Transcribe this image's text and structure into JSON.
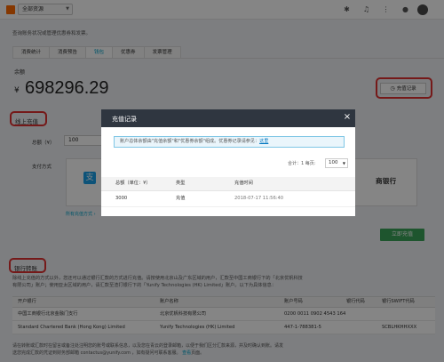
{
  "topbar": {
    "resource_select": "全部资源",
    "icons": [
      "cloudshell-icon",
      "bell-icon",
      "cart-icon",
      "help-icon",
      "avatar"
    ]
  },
  "info_strip": "查询账务状况或管理优惠券和发票。",
  "tabs": [
    {
      "label": "消费统计",
      "active": false
    },
    {
      "label": "消费预告",
      "active": false
    },
    {
      "label": "钱包",
      "active": true
    },
    {
      "label": "优惠券",
      "active": false
    },
    {
      "label": "发票管理",
      "active": false
    }
  ],
  "balance": {
    "label": "余额",
    "currency": "¥",
    "amount": "698296.29",
    "records_button": "充值记录"
  },
  "online": {
    "title": "线上充值",
    "amount_label": "总额（¥）",
    "amount_value": "100",
    "pay_label": "支付方式",
    "alipay_glyph": "支",
    "bank_text": "商银行",
    "more_link": "所有充值方式 ›",
    "pay_button": "立即充值"
  },
  "bank": {
    "title": "银行转账",
    "desc1": "除线上充值的方式以外，您还可以通过银行汇款的方式进行充值。请按使用北京山及广东区域的用户，汇款至中国工商银行下的「北京优帆科技",
    "desc2": "有限公司」账户；使用亚太区域的用户，请汇款至渣打银行下的「Yunify Technologies (HK) Limited」账户。以下为具体信息：",
    "headers": [
      "开户银行",
      "账户名称",
      "账户号码",
      "银行代码",
      "银行SWIFT代码"
    ],
    "rows": [
      [
        "中国工商银行北京金融门支行",
        "北京优帆科技有限公司",
        "0200 0011 0902 4543 164",
        "",
        ""
      ],
      [
        "Standard Chartered Bank (Hong Kong) Limited",
        "Yunify Technologies (HK) Limited",
        "447-1-788381-5",
        "",
        "SCBLHKHHXXX"
      ]
    ],
    "foot1": "请在转账或汇款时在留言或备注处注明您的账号或联系信息，以及您在青云的登录邮箱，以便于我们区分汇款来源，并及时确认到账。请发",
    "foot2": "送您完成汇款的凭证到财务部邮箱 contactus@yunify.com ，如有疑问可联系客服。",
    "foot_link": "查看",
    "foot3": "页面。"
  },
  "modal": {
    "title": "充值记录",
    "close": "×",
    "notice_text": "账户总体余额由\"充值余额\"和\"优惠券余额\"组成。优惠券记录请参见：",
    "notice_link": "这里",
    "pager_text": "合计：1  每页:",
    "page_size": "100",
    "columns": [
      "总额（单位：¥）",
      "类型",
      "充值时间"
    ],
    "rows": [
      {
        "amount": "3000",
        "type": "充值",
        "time": "2018-07-17 11:56:40"
      }
    ]
  },
  "annotation_color": "#e03030",
  "accent_color": "#00a2ca",
  "button_color": "#3aa358"
}
